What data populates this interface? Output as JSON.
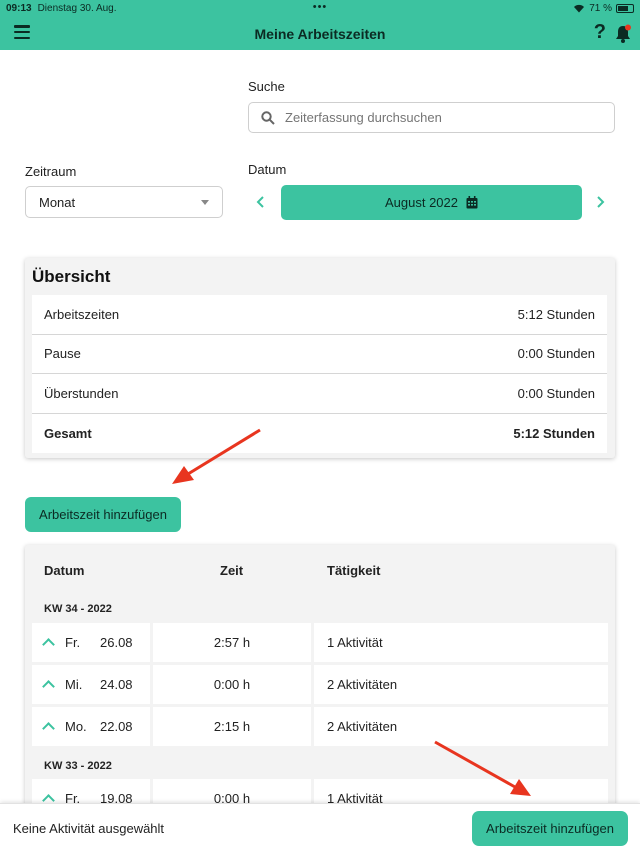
{
  "status_bar": {
    "time": "09:13",
    "date": "Dienstag 30. Aug.",
    "battery": "71 %",
    "battery_level": 0.71
  },
  "header": {
    "title": "Meine Arbeitszeiten",
    "help": "?"
  },
  "search": {
    "label": "Suche",
    "placeholder": "Zeiterfassung durchsuchen"
  },
  "period": {
    "label": "Zeitraum",
    "value": "Monat"
  },
  "date": {
    "label": "Datum",
    "value": "August 2022"
  },
  "overview": {
    "title": "Übersicht",
    "rows": [
      {
        "label": "Arbeitszeiten",
        "value": "5:12 Stunden"
      },
      {
        "label": "Pause",
        "value": "0:00 Stunden"
      },
      {
        "label": "Überstunden",
        "value": "0:00 Stunden"
      },
      {
        "label": "Gesamt",
        "value": "5:12 Stunden"
      }
    ]
  },
  "add_button": "Arbeitszeit hinzufügen",
  "table": {
    "headers": [
      "Datum",
      "Zeit",
      "Tätigkeit"
    ],
    "weeks": [
      {
        "label": "KW 34 - 2022",
        "rows": [
          {
            "day": "Fr.",
            "date": "26.08",
            "time": "2:57 h",
            "activity": "1 Aktivität"
          },
          {
            "day": "Mi.",
            "date": "24.08",
            "time": "0:00 h",
            "activity": "2 Aktivitäten"
          },
          {
            "day": "Mo.",
            "date": "22.08",
            "time": "2:15 h",
            "activity": "2 Aktivitäten"
          }
        ]
      },
      {
        "label": "KW 33 - 2022",
        "rows": [
          {
            "day": "Fr.",
            "date": "19.08",
            "time": "0:00 h",
            "activity": "1 Aktivität"
          }
        ]
      }
    ]
  },
  "bottom_bar": {
    "status": "Keine Aktivität ausgewählt",
    "button": "Arbeitszeit hinzufügen"
  },
  "colors": {
    "accent": "#3cc3a0",
    "annotation_arrow": "#e8351f"
  }
}
